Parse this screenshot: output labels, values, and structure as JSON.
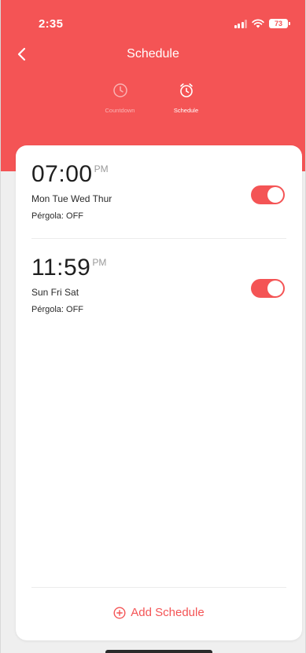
{
  "status_bar": {
    "time": "2:35",
    "battery": "73"
  },
  "header": {
    "title": "Schedule",
    "tabs": [
      {
        "label": "Countdown",
        "icon": "clock-icon",
        "active": false
      },
      {
        "label": "Schedule",
        "icon": "alarm-clock-icon",
        "active": true
      }
    ]
  },
  "schedules": [
    {
      "time": "07:00",
      "ampm": "PM",
      "days": "Mon Tue Wed Thur",
      "status": "Pérgola: OFF",
      "enabled": true
    },
    {
      "time": "11:59",
      "ampm": "PM",
      "days": "Sun Fri Sat",
      "status": "Pérgola: OFF",
      "enabled": true
    }
  ],
  "add_button": {
    "label": "Add Schedule",
    "icon": "plus-circle-icon"
  },
  "colors": {
    "accent": "#f45455",
    "background": "#efefef",
    "card": "#ffffff"
  }
}
